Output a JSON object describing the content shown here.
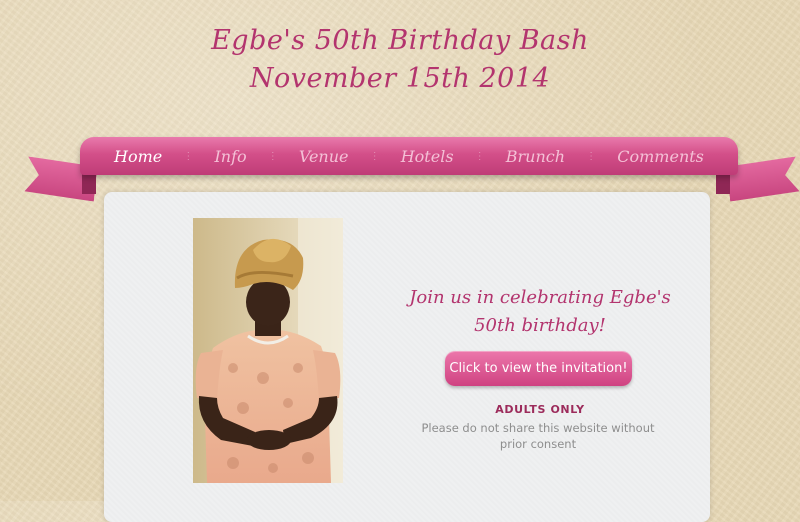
{
  "header": {
    "title_line1": "Egbe's 50th Birthday Bash",
    "title_line2": "November 15th 2014"
  },
  "nav": {
    "items": [
      "Home",
      "Info",
      "Venue",
      "Hotels",
      "Brunch",
      "Comments"
    ],
    "active": "Home"
  },
  "main": {
    "heading_line1": "Join us in celebrating Egbe's",
    "heading_line2": "50th birthday!",
    "invitation_button": "Click to view the invitation!",
    "adults_only": "ADULTS ONLY",
    "notice": "Please do not share this website without prior consent",
    "photo_icon": "portrait-photo"
  },
  "colors": {
    "accent": "#b3346e",
    "ribbon": "#d34f89",
    "background": "#e8d8b6",
    "card": "#eff0f1"
  }
}
